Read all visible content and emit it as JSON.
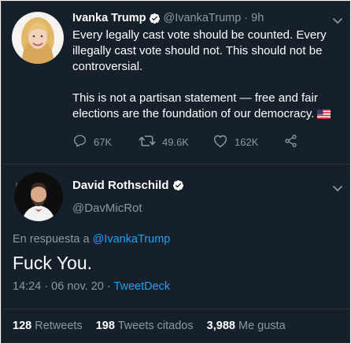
{
  "parent_tweet": {
    "display_name": "Ivanka Trump",
    "handle": "@IvankaTrump",
    "separator": "·",
    "time_ago": "9h",
    "paragraph_1": "Every legally cast vote should be counted. Every illegally cast vote should not. This should not be controversial.",
    "paragraph_2": "This is not a partisan statement — free and fair elections are the foundation of our democracy.",
    "flag_icon": "us-flag-icon",
    "replies": "67K",
    "retweets": "49.6K",
    "likes": "162K"
  },
  "reply_tweet": {
    "display_name": "David Rothschild",
    "handle": "@DavMicRot",
    "reply_prefix": "En respuesta a",
    "reply_to": "@IvankaTrump",
    "text": "Fuck You.",
    "timestamp": "14:24 · 06 nov. 20 · ",
    "source": "TweetDeck",
    "retweets_count": "128",
    "retweets_label": "Retweets",
    "quotes_count": "198",
    "quotes_label": "Tweets citados",
    "likes_count": "3,988",
    "likes_label": "Me gusta"
  },
  "colors": {
    "background": "#15202b",
    "muted": "#8899a6",
    "link": "#1da1f2",
    "verified": "#ffffff"
  }
}
